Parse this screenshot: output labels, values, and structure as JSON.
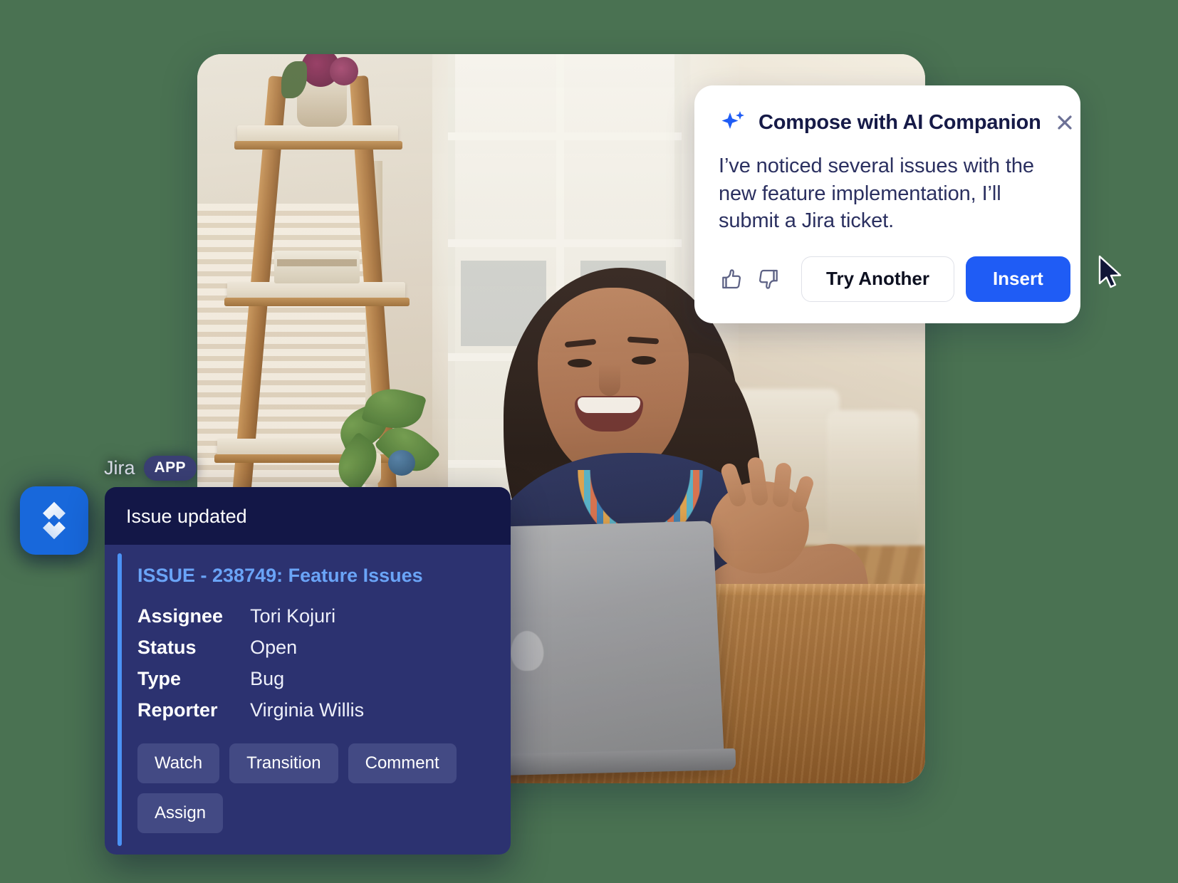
{
  "theme": {
    "page_background": "#4a7252",
    "accent_blue": "#1f5cf5",
    "jira_logo_blue": "#1868db",
    "jira_card_header": "#131747",
    "jira_card_body": "#2c3270",
    "jira_link_blue": "#6aa4f7",
    "jira_accent_bar": "#4b92f5",
    "popover_text": "#2b3060",
    "popover_title": "#161a47",
    "close_icon": "#6b7095"
  },
  "photo": {
    "alt": "Woman smiling at a laptop in a bright home office with a wooden ladder shelf and window blinds"
  },
  "ai_popover": {
    "sparkle_icon": "sparkle-icon",
    "title": "Compose with AI Companion",
    "close_icon": "close-icon",
    "message": "I’ve noticed several issues with the new feature implementation, I’ll submit a Jira ticket.",
    "thumbs_up_icon": "thumbs-up-icon",
    "thumbs_down_icon": "thumbs-down-icon",
    "try_another_label": "Try Another",
    "insert_label": "Insert",
    "cursor_icon": "mouse-pointer-icon"
  },
  "jira_badge": {
    "app_name": "Jira",
    "app_tag": "APP",
    "logo_icon": "jira-logo-icon"
  },
  "jira_card": {
    "header_title": "Issue updated",
    "issue_link": "ISSUE - 238749: Feature Issues",
    "fields": [
      {
        "key": "Assignee",
        "value": "Tori Kojuri"
      },
      {
        "key": "Status",
        "value": "Open"
      },
      {
        "key": "Type",
        "value": "Bug"
      },
      {
        "key": "Reporter",
        "value": "Virginia Willis"
      }
    ],
    "actions": [
      "Watch",
      "Transition",
      "Comment",
      "Assign"
    ]
  }
}
